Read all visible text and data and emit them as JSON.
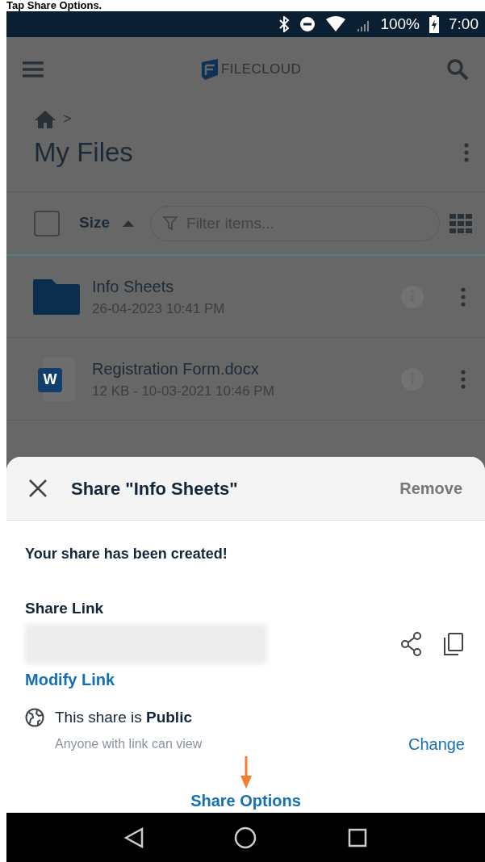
{
  "caption": "Tap Share Options.",
  "status_bar": {
    "battery": "100%",
    "time": "7:00"
  },
  "app_bar": {
    "logo_text": "FILECLOUD"
  },
  "breadcrumb": {
    "separator": ">"
  },
  "title": "My Files",
  "toolbar": {
    "select_all_checked": false,
    "sort_label": "Size",
    "filter": {
      "placeholder": "Filter items..."
    }
  },
  "files": [
    {
      "kind": "folder",
      "name": "Info Sheets",
      "meta": "26-04-2023 10:41 PM"
    },
    {
      "kind": "word",
      "name": "Registration Form.docx",
      "meta": "12 KB - 10-03-2021 10:46 PM",
      "badge": "W"
    }
  ],
  "share_sheet": {
    "title": "Share \"Info Sheets\"",
    "remove": "Remove",
    "message": "Your share has been created!",
    "link_label": "Share Link",
    "modify_link": "Modify Link",
    "visibility": "This share is **Public**",
    "visibility_note": "Anyone with link can view",
    "change": "Change",
    "share_options": "Share Options"
  }
}
